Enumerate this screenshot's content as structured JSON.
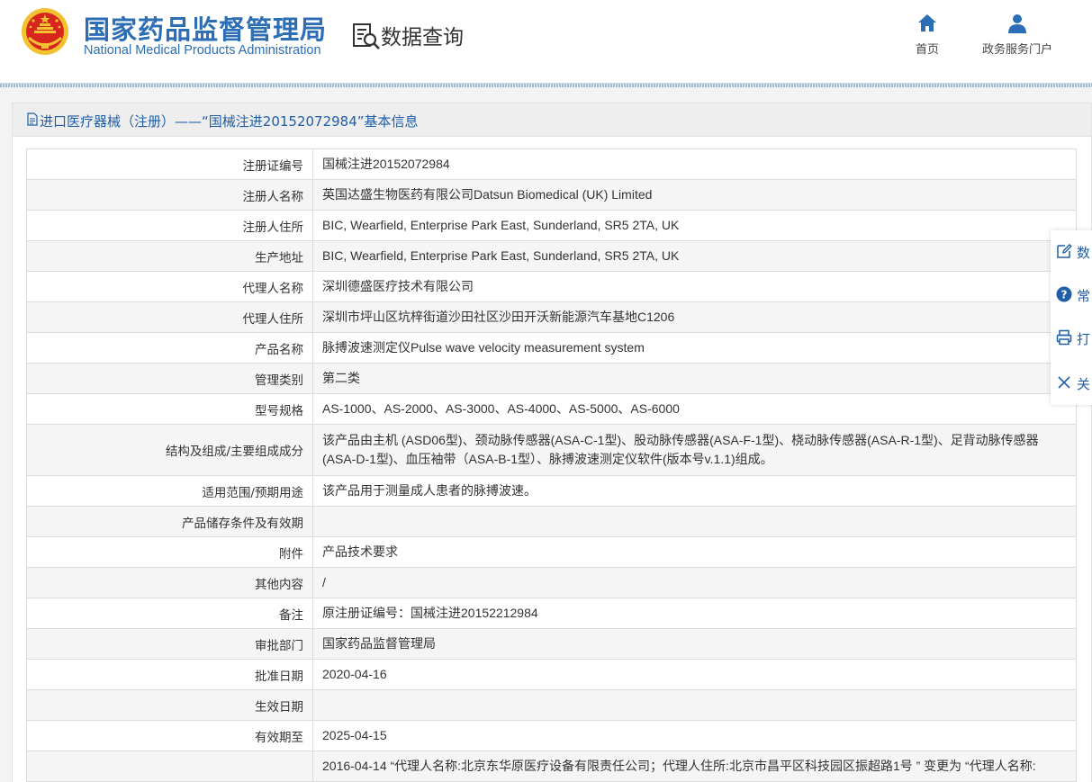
{
  "header": {
    "brand_cn": "国家药品监督管理局",
    "brand_en": "National Medical Products Administration",
    "query_title": "数据查询",
    "nav": [
      {
        "label": "首页",
        "icon": "home-icon"
      },
      {
        "label": "政务服务门户",
        "icon": "user-icon"
      }
    ]
  },
  "panel": {
    "title": "进口医疗器械（注册）——“国械注进20152072984”基本信息"
  },
  "rows": [
    {
      "label": "注册证编号",
      "value": "国械注进20152072984"
    },
    {
      "label": "注册人名称",
      "value": "英国达盛生物医药有限公司Datsun Biomedical (UK) Limited"
    },
    {
      "label": "注册人住所",
      "value": "BIC, Wearfield, Enterprise Park East, Sunderland, SR5 2TA, UK"
    },
    {
      "label": "生产地址",
      "value": "BIC, Wearfield, Enterprise Park East, Sunderland, SR5 2TA, UK"
    },
    {
      "label": "代理人名称",
      "value": "深圳德盛医疗技术有限公司"
    },
    {
      "label": "代理人住所",
      "value": "深圳市坪山区坑梓街道沙田社区沙田开沃新能源汽车基地C1206"
    },
    {
      "label": "产品名称",
      "value": "脉搏波速测定仪Pulse wave velocity measurement system"
    },
    {
      "label": "管理类别",
      "value": "第二类"
    },
    {
      "label": "型号规格",
      "value": "AS-1000、AS-2000、AS-3000、AS-4000、AS-5000、AS-6000"
    },
    {
      "label": "结构及组成/主要组成成分",
      "value": "该产品由主机 (ASD06型)、颈动脉传感器(ASA-C-1型)、股动脉传感器(ASA-F-1型)、桡动脉传感器(ASA-R-1型)、足背动脉传感器(ASA-D-1型)、血压袖带（ASA-B-1型）、脉搏波速测定仪软件(版本号v.1.1)组成。"
    },
    {
      "label": "适用范围/预期用途",
      "value": "该产品用于测量成人患者的脉搏波速。"
    },
    {
      "label": "产品储存条件及有效期",
      "value": ""
    },
    {
      "label": "附件",
      "value": "产品技术要求"
    },
    {
      "label": "其他内容",
      "value": "/"
    },
    {
      "label": "备注",
      "value": "原注册证编号：国械注进20152212984"
    },
    {
      "label": "审批部门",
      "value": "国家药品监督管理局"
    },
    {
      "label": "批准日期",
      "value": "2020-04-16"
    },
    {
      "label": "生效日期",
      "value": ""
    },
    {
      "label": "有效期至",
      "value": "2025-04-15"
    },
    {
      "label": "",
      "value": "2016-04-14 “代理人名称:北京东华原医疗设备有限责任公司；代理人住所:北京市昌平区科技园区振超路1号 ” 变更为 “代理人名称:"
    }
  ],
  "side_toolbar": [
    {
      "label": "数",
      "icon": "edit-icon"
    },
    {
      "label": "常",
      "icon": "help-icon"
    },
    {
      "label": "打",
      "icon": "print-icon"
    },
    {
      "label": "关",
      "icon": "close-icon"
    }
  ],
  "colors": {
    "brand": "#2c6eb5",
    "title_link": "#1f5fa8",
    "emblem_red": "#d7261e",
    "emblem_gold": "#f2c230"
  }
}
